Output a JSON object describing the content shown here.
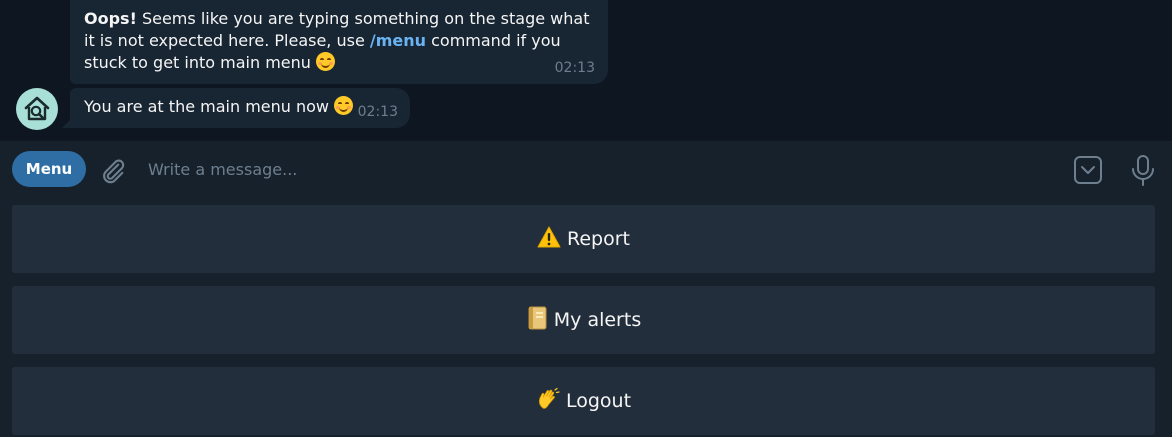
{
  "messages": [
    {
      "bold_prefix": "Oops!",
      "text_part1": " Seems like you are typing something on the stage what it is not expected here. Please, use ",
      "command": "/menu",
      "text_part2": " command if you stuck to get into main menu",
      "time": "02:13"
    },
    {
      "text": "You are at the main menu now",
      "time": "02:13"
    }
  ],
  "input_bar": {
    "menu_label": "Menu",
    "placeholder": "Write a message..."
  },
  "keyboard": {
    "buttons": [
      {
        "label": "Report",
        "icon": "warning-icon"
      },
      {
        "label": "My alerts",
        "icon": "notebook-icon"
      },
      {
        "label": "Logout",
        "icon": "waving-hand-icon"
      }
    ]
  },
  "colors": {
    "chat_background": "#0e1621",
    "bubble": "#182533",
    "accent": "#2f6ea5",
    "link": "#6ab3f3",
    "keyboard_button": "#232e3c"
  }
}
